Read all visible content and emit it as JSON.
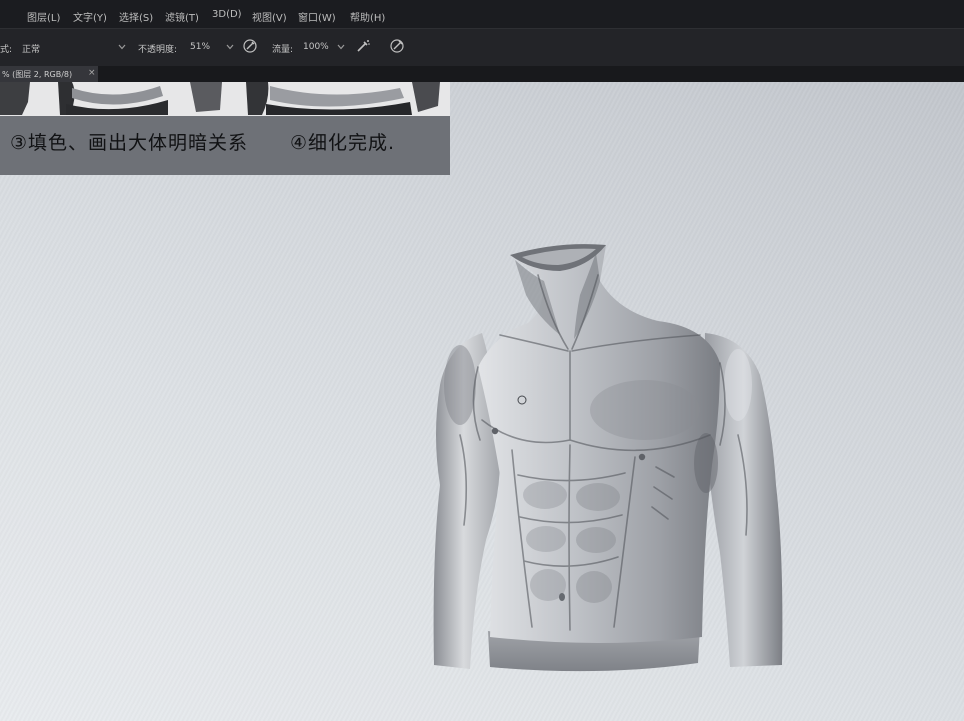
{
  "menu": {
    "items": [
      "图层(L)",
      "文字(Y)",
      "选择(S)",
      "滤镜(T)",
      "3D(D)",
      "视图(V)",
      "窗口(W)",
      "帮助(H)"
    ]
  },
  "options": {
    "mode_label": "式:",
    "mode_value": "正常",
    "opacity_label": "不透明度:",
    "opacity_value": "51%",
    "flow_label": "流量:",
    "flow_value": "100%",
    "dropdown_icon": "chevron-down-icon",
    "icons": [
      "pen-pressure-opacity-icon",
      "airbrush-icon",
      "pen-pressure-size-icon"
    ]
  },
  "document_tab": {
    "title": "% (图层 2, RGB/8)",
    "close": "×"
  },
  "reference_image": {
    "captions": [
      "③填色、画出大体明暗关系",
      "④细化完成."
    ]
  },
  "colors": {
    "menu_bg": "#1d1e22",
    "options_bg": "#232428",
    "canvas_bg": "#d6dade",
    "caption_band": "#6e7177"
  }
}
